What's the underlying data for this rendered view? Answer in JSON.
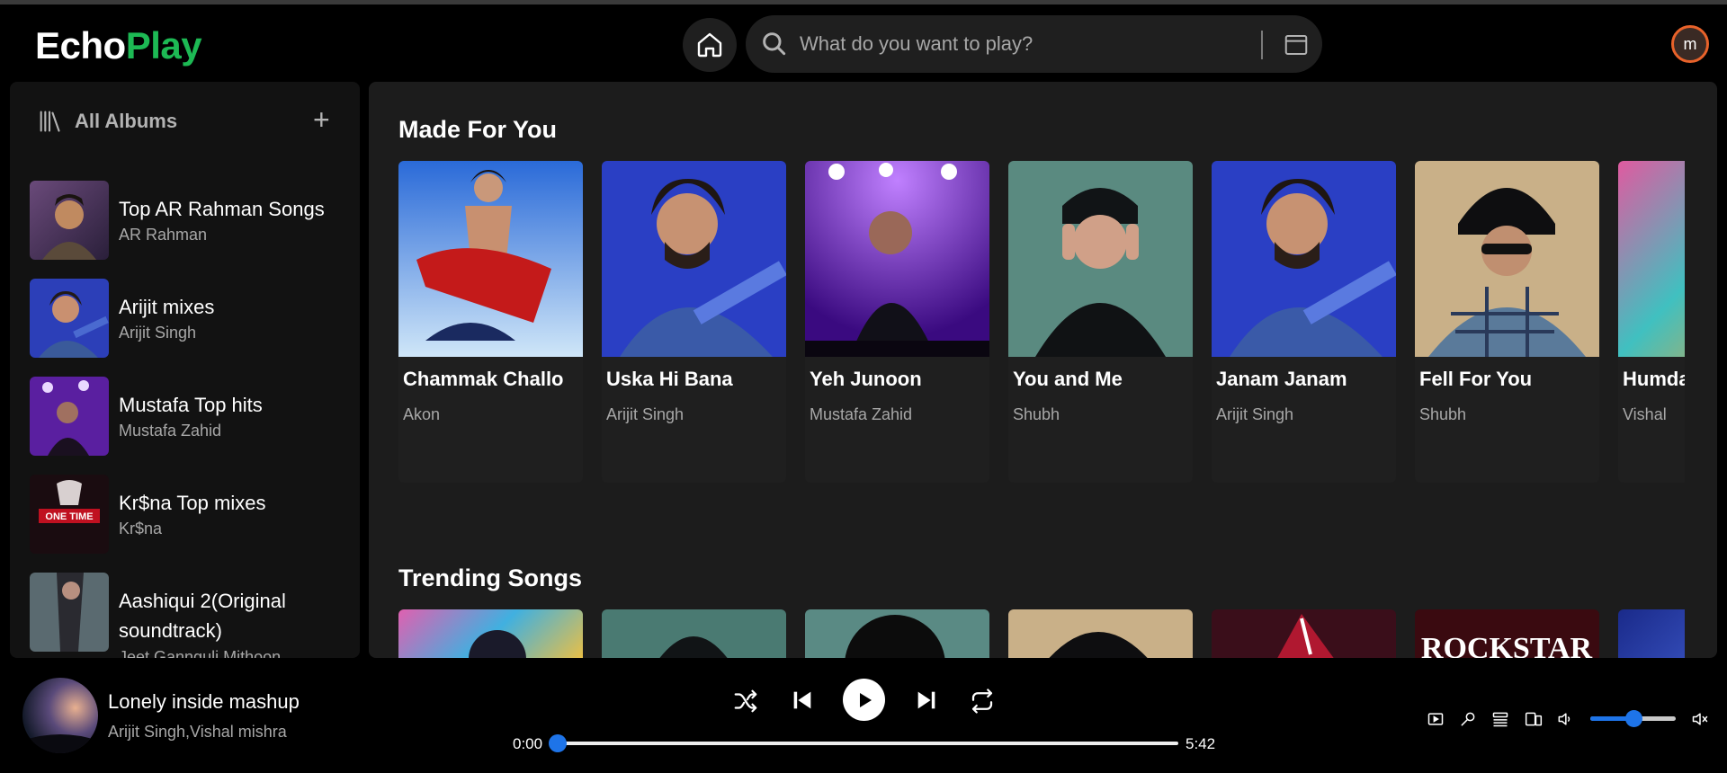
{
  "app": {
    "logo_part1": "Echo",
    "logo_part2": "Play",
    "brand_color": "#1db954"
  },
  "header": {
    "search_placeholder": "What do you want to play?",
    "avatar_initial": "m"
  },
  "sidebar": {
    "title": "All Albums",
    "add_label": "+",
    "albums": [
      {
        "title": "Top AR Rahman Songs",
        "artist": "AR Rahman"
      },
      {
        "title": "Arijit mixes",
        "artist": "Arijit Singh"
      },
      {
        "title": "Mustafa Top hits",
        "artist": "Mustafa Zahid"
      },
      {
        "title": "Kr$na Top mixes",
        "artist": "Kr$na"
      },
      {
        "title": "Aashiqui 2(Original soundtrack)",
        "artist": "Jeet Gannguli,Mithoon"
      }
    ]
  },
  "main": {
    "made_for_you": {
      "title": "Made For You",
      "cards": [
        {
          "title": "Chammak Challo",
          "artist": "Akon"
        },
        {
          "title": "Uska Hi Bana",
          "artist": "Arijit Singh"
        },
        {
          "title": "Yeh Junoon",
          "artist": "Mustafa Zahid"
        },
        {
          "title": "You and Me",
          "artist": "Shubh"
        },
        {
          "title": "Janam Janam",
          "artist": "Arijit Singh"
        },
        {
          "title": "Fell For You",
          "artist": "Shubh"
        },
        {
          "title": "Humdard",
          "artist": "Vishal"
        }
      ]
    },
    "trending": {
      "title": "Trending Songs",
      "partial_art_text": "ROCKSTAR"
    }
  },
  "player": {
    "title": "Lonely inside mashup",
    "artist": "Arijit Singh,Vishal mishra",
    "current_time": "0:00",
    "total_time": "5:42",
    "progress": 0,
    "volume": 0.5,
    "accent_color": "#1e74e8"
  }
}
